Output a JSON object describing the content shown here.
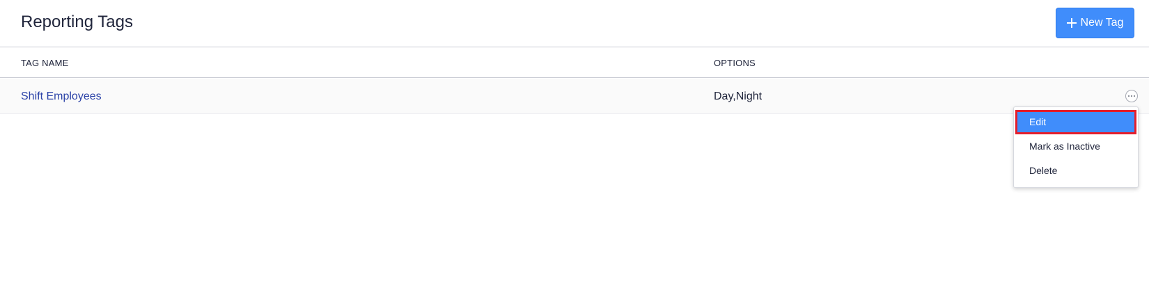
{
  "header": {
    "title": "Reporting Tags",
    "new_tag_label": "New Tag"
  },
  "table": {
    "columns": [
      "TAG NAME",
      "OPTIONS"
    ],
    "rows": [
      {
        "tag_name": "Shift Employees",
        "options": "Day,Night"
      }
    ]
  },
  "row_menu": {
    "items": [
      "Edit",
      "Mark as Inactive",
      "Delete"
    ],
    "highlighted": "Edit"
  },
  "colors": {
    "accent": "#408dfb",
    "link": "#2d44a8",
    "highlight_outline": "#e41e2b"
  },
  "icons": {
    "new_tag": "plus-icon",
    "row_actions": "more-horizontal-icon"
  }
}
